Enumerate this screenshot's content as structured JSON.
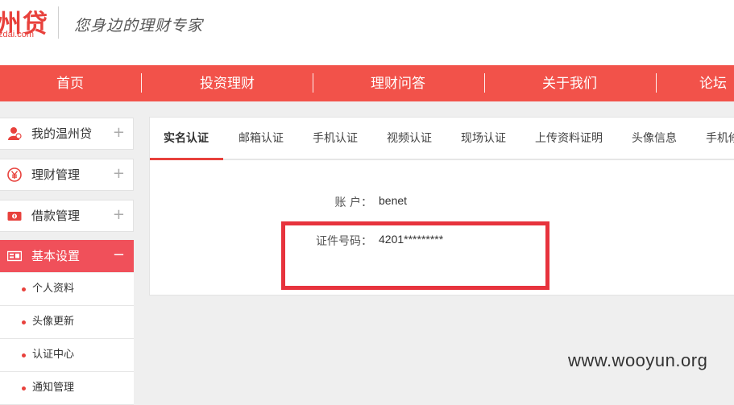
{
  "header": {
    "logo_text": "州贷",
    "logo_domain": "zdai.com",
    "slogan": "您身边的理财专家"
  },
  "nav": {
    "items": [
      {
        "label": "首页"
      },
      {
        "label": "投资理财"
      },
      {
        "label": "理财问答"
      },
      {
        "label": "关于我们"
      },
      {
        "label": "论坛"
      }
    ]
  },
  "sidebar": {
    "items": [
      {
        "label": "我的温州贷",
        "toggle": "+",
        "icon": "user-icon"
      },
      {
        "label": "理财管理",
        "toggle": "+",
        "icon": "yen-icon"
      },
      {
        "label": "借款管理",
        "toggle": "+",
        "icon": "money-icon"
      },
      {
        "label": "基本设置",
        "toggle": "−",
        "icon": "settings-card-icon"
      }
    ],
    "sub_items": [
      {
        "label": "个人资料"
      },
      {
        "label": "头像更新"
      },
      {
        "label": "认证中心"
      },
      {
        "label": "通知管理"
      }
    ]
  },
  "tabs": [
    {
      "label": "实名认证"
    },
    {
      "label": "邮箱认证"
    },
    {
      "label": "手机认证"
    },
    {
      "label": "视频认证"
    },
    {
      "label": "现场认证"
    },
    {
      "label": "上传资料证明"
    },
    {
      "label": "头像信息"
    },
    {
      "label": "手机修改"
    }
  ],
  "form": {
    "account_label": "账 户：",
    "account_value": "benet",
    "id_label": "证件号码：",
    "id_value": "4201*********"
  },
  "watermark": "www.wooyun.org",
  "colors": {
    "brand": "#f2524a",
    "highlight": "#e7333d"
  }
}
